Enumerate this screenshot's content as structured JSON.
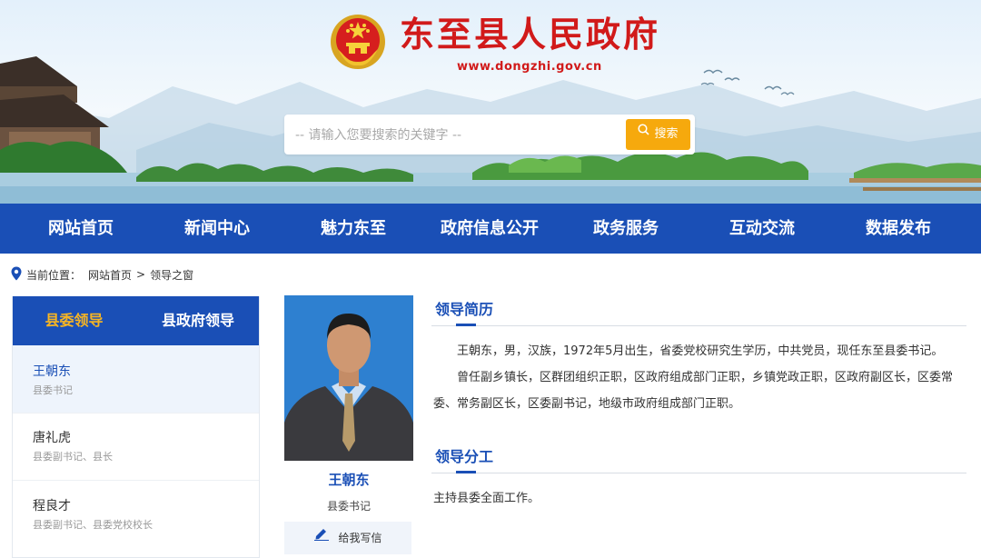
{
  "header": {
    "site_title": "东至县人民政府",
    "site_url": "www.dongzhi.gov.cn",
    "search": {
      "placeholder": "-- 请输入您要搜索的关键字 --",
      "button_label": "搜索"
    }
  },
  "nav": {
    "items": [
      {
        "label": "网站首页"
      },
      {
        "label": "新闻中心"
      },
      {
        "label": "魅力东至"
      },
      {
        "label": "政府信息公开"
      },
      {
        "label": "政务服务"
      },
      {
        "label": "互动交流"
      },
      {
        "label": "数据发布"
      }
    ]
  },
  "breadcrumb": {
    "prefix": "当前位置：",
    "home": "网站首页",
    "separator": ">",
    "current": "领导之窗"
  },
  "sidebar": {
    "tabs": [
      {
        "label": "县委领导",
        "active": true
      },
      {
        "label": "县政府领导",
        "active": false
      }
    ],
    "leaders": [
      {
        "name": "王朝东",
        "role": "县委书记",
        "active": true
      },
      {
        "name": "唐礼虎",
        "role": "县委副书记、县长",
        "active": false
      },
      {
        "name": "程良才",
        "role": "县委副书记、县委党校校长",
        "active": false
      }
    ]
  },
  "profile": {
    "name": "王朝东",
    "role": "县委书记",
    "write_letter_label": "给我写信",
    "resume_title": "领导简历",
    "resume_paragraphs": [
      "王朝东，男，汉族，1972年5月出生，省委党校研究生学历，中共党员，现任东至县委书记。",
      "曾任副乡镇长，区群团组织正职，区政府组成部门正职，乡镇党政正职，区政府副区长，区委常委、常务副区长，区委副书记，地级市政府组成部门正职。"
    ],
    "duty_title": "领导分工",
    "duty_text": "主持县委全面工作。"
  },
  "colors": {
    "primary_blue": "#1a4fb6",
    "title_red": "#d11a1a",
    "accent_orange": "#f6a90d",
    "active_tab_gold": "#f7b523"
  }
}
